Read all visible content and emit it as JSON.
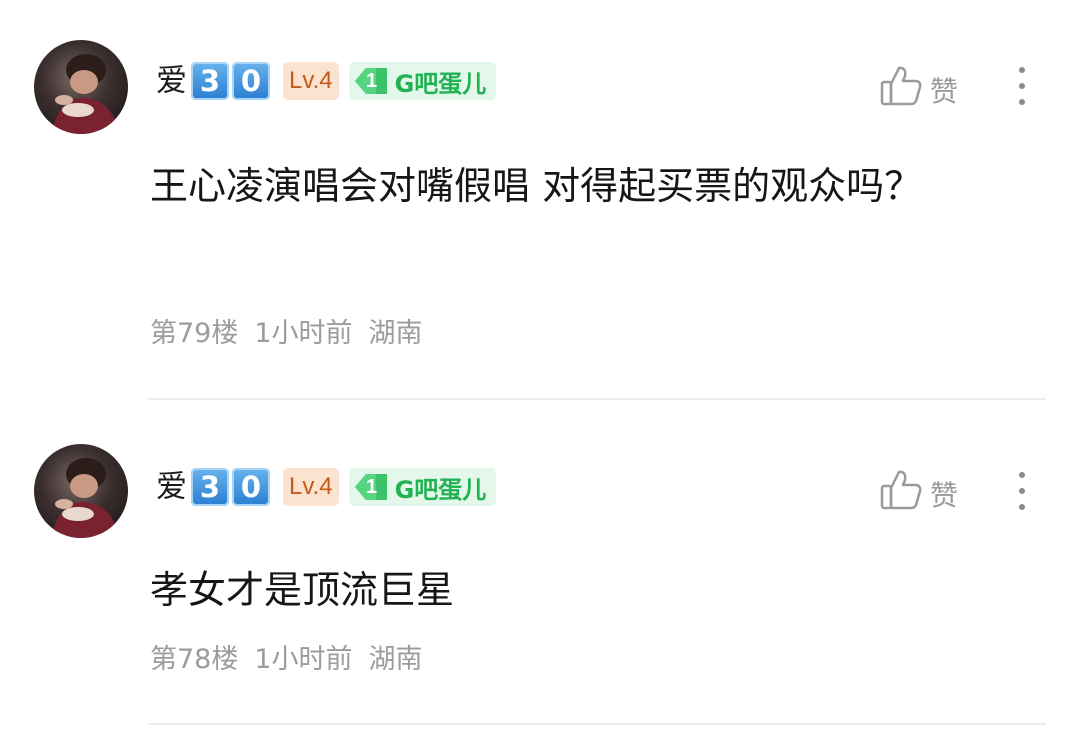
{
  "comments": [
    {
      "username_prefix": "爱",
      "username_keys": [
        "3",
        "0"
      ],
      "level": "Lv.4",
      "badge_number": "1",
      "badge_label": "G吧蛋儿",
      "like_label": "赞",
      "content": "王心凌演唱会对嘴假唱 对得起买票的观众吗？",
      "floor": "第79楼",
      "time": "1小时前",
      "location": "湖南"
    },
    {
      "username_prefix": "爱",
      "username_keys": [
        "3",
        "0"
      ],
      "level": "Lv.4",
      "badge_number": "1",
      "badge_label": "G吧蛋儿",
      "like_label": "赞",
      "content": "孝女才是顶流巨星",
      "floor": "第78楼",
      "time": "1小时前",
      "location": "湖南"
    }
  ],
  "colors": {
    "level_bg": "#fbe3cf",
    "level_text": "#c65a18",
    "badge_bg": "#e3f7ea",
    "badge_text": "#21b352",
    "meta_text": "#9c9c9c"
  },
  "icons": [
    "thumb-up-icon",
    "more-vertical-icon",
    "diamond-gem-icon"
  ]
}
